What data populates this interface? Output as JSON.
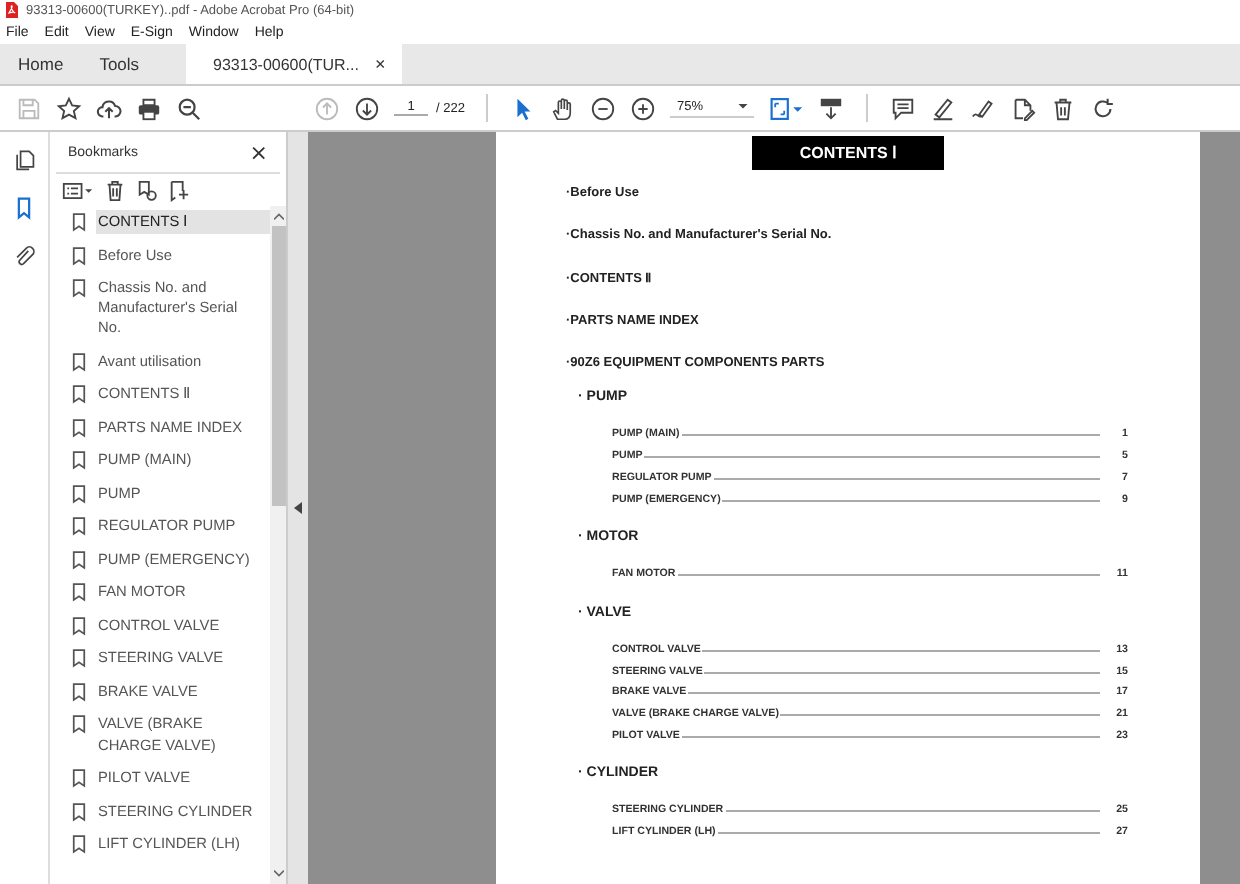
{
  "window": {
    "title": "93313-00600(TURKEY)..pdf - Adobe Acrobat Pro (64-bit)"
  },
  "menu": [
    "File",
    "Edit",
    "View",
    "E-Sign",
    "Window",
    "Help"
  ],
  "tabs": [
    {
      "label": "Home",
      "selected": false
    },
    {
      "label": "Tools",
      "selected": false
    },
    {
      "label": "93313-00600(TUR...",
      "selected": true,
      "close": "×"
    }
  ],
  "toolbar": {
    "page": "1",
    "page_total": "/ 222",
    "zoom": "75%"
  },
  "bookmarks": {
    "title": "Bookmarks",
    "close": "×",
    "items": [
      {
        "label": "CONTENTS Ⅰ",
        "selected": true
      },
      {
        "label": "Before Use",
        "selected": false
      },
      {
        "label": "Chassis No. and Manufacturer's Serial No.",
        "selected": false
      },
      {
        "label": "Avant utilisation",
        "selected": false
      },
      {
        "label": "CONTENTS Ⅱ",
        "selected": false
      },
      {
        "label": "PARTS NAME INDEX",
        "selected": false
      },
      {
        "label": "PUMP (MAIN)",
        "selected": false
      },
      {
        "label": "PUMP",
        "selected": false
      },
      {
        "label": "REGULATOR PUMP",
        "selected": false
      },
      {
        "label": "PUMP (EMERGENCY)",
        "selected": false
      },
      {
        "label": "FAN MOTOR",
        "selected": false
      },
      {
        "label": "CONTROL VALVE",
        "selected": false
      },
      {
        "label": "STEERING VALVE",
        "selected": false
      },
      {
        "label": "BRAKE VALVE",
        "selected": false
      },
      {
        "label": "VALVE (BRAKE CHARGE VALVE)",
        "selected": false
      },
      {
        "label": "PILOT VALVE",
        "selected": false
      },
      {
        "label": "STEERING CYLINDER",
        "selected": false
      },
      {
        "label": "LIFT CYLINDER (LH)",
        "selected": false
      }
    ]
  },
  "document": {
    "heading": "CONTENTS Ⅰ",
    "top_entries": [
      "·Before Use",
      "·Chassis No. and Manufacturer's Serial No.",
      "·CONTENTS Ⅱ",
      "·PARTS NAME INDEX",
      "·90Z6 EQUIPMENT COMPONENTS PARTS"
    ],
    "sections": [
      {
        "title": "· PUMP",
        "entries": [
          {
            "label": "PUMP (MAIN)",
            "page": "1"
          },
          {
            "label": "PUMP",
            "page": "5"
          },
          {
            "label": "REGULATOR PUMP",
            "page": "7"
          },
          {
            "label": "PUMP (EMERGENCY)",
            "page": "9"
          }
        ]
      },
      {
        "title": "· MOTOR",
        "entries": [
          {
            "label": "FAN MOTOR",
            "page": "11"
          }
        ]
      },
      {
        "title": "· VALVE",
        "entries": [
          {
            "label": "CONTROL VALVE",
            "page": "13"
          },
          {
            "label": "STEERING VALVE",
            "page": "15"
          },
          {
            "label": "BRAKE VALVE",
            "page": "17"
          },
          {
            "label": "VALVE (BRAKE CHARGE VALVE)",
            "page": "21"
          },
          {
            "label": "PILOT VALVE",
            "page": "23"
          }
        ]
      },
      {
        "title": "· CYLINDER",
        "entries": [
          {
            "label": "STEERING CYLINDER",
            "page": "25"
          },
          {
            "label": "LIFT CYLINDER (LH)",
            "page": "27"
          }
        ]
      }
    ]
  }
}
